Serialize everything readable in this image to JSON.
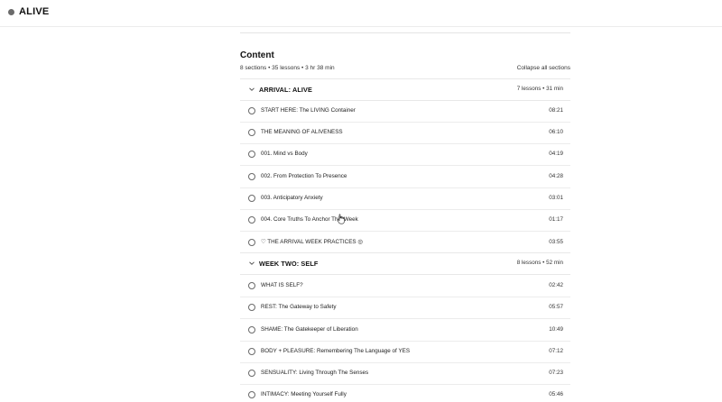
{
  "app": {
    "name": "ALIVE"
  },
  "content": {
    "title": "Content",
    "meta": "8 sections • 35 lessons • 3 hr 38 min",
    "collapse_label": "Collapse all sections"
  },
  "sections": [
    {
      "name": "ARRIVAL: ALIVE",
      "info": "7 lessons • 31 min",
      "lessons": [
        {
          "title": "START HERE: The LIVING Container",
          "duration": "08:21"
        },
        {
          "title": "THE MEANING OF ALIVENESS",
          "duration": "06:10"
        },
        {
          "title": "001. Mind vs Body",
          "duration": "04:19"
        },
        {
          "title": "002. From Protection To Presence",
          "duration": "04:28"
        },
        {
          "title": "003. Anticipatory Anxiety",
          "duration": "03:01"
        },
        {
          "title": "004. Core Truths To Anchor This Week",
          "duration": "01:17"
        },
        {
          "title": "♡ THE ARRIVAL WEEK PRACTICES ◎",
          "duration": "03:55"
        }
      ]
    },
    {
      "name": "WEEK TWO: SELF",
      "info": "8 lessons • 52 min",
      "lessons": [
        {
          "title": "WHAT IS SELF?",
          "duration": "02:42"
        },
        {
          "title": "REST: The Gateway to Safety",
          "duration": "05:57"
        },
        {
          "title": "SHAME: The Gatekeeper of Liberation",
          "duration": "10:49"
        },
        {
          "title": "BODY + PLEASURE: Remembering The Language of YES",
          "duration": "07:12"
        },
        {
          "title": "SENSUALITY: Living Through The Senses",
          "duration": "07:23"
        },
        {
          "title": "INTIMACY: Meeting Yourself Fully",
          "duration": "05:46"
        }
      ]
    }
  ]
}
